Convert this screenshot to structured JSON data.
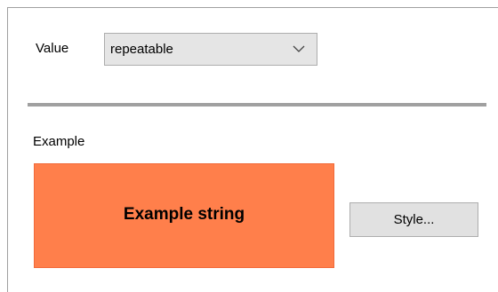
{
  "value_row": {
    "label": "Value",
    "selected": "repeatable"
  },
  "example": {
    "label": "Example",
    "preview_text": "Example string",
    "preview_bg": "#ff7f4b"
  },
  "buttons": {
    "style_label": "Style..."
  },
  "icons": {
    "dropdown": "chevron-down-icon"
  }
}
